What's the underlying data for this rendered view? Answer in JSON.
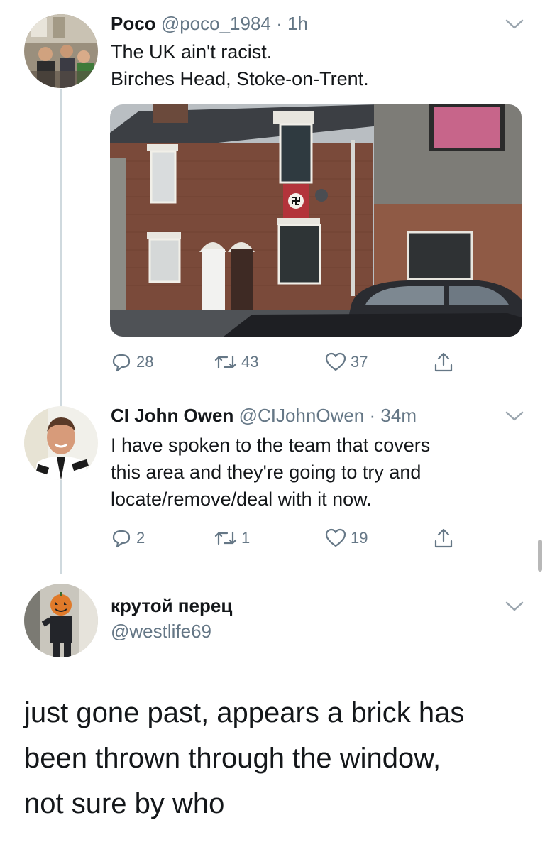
{
  "tweets": [
    {
      "name": "Poco",
      "handle": "@poco_1984",
      "time": "· 1h",
      "lines": [
        "The UK ain't racist.",
        "Birches Head, Stoke-on-Trent."
      ],
      "replies": "28",
      "retweets": "43",
      "likes": "37"
    },
    {
      "name": "CI John Owen",
      "handle": "@CIJohnOwen",
      "time": "· 34m",
      "lines": [
        "I have spoken to the team that covers",
        "this area and they're going to try and",
        "locate/remove/deal with it now."
      ],
      "replies": "2",
      "retweets": "1",
      "likes": "19"
    }
  ],
  "reply": {
    "name": "крутой перец",
    "handle": "@westlife69",
    "lines": [
      "just gone past, appears a brick has",
      "been thrown through the window,",
      "not sure by who"
    ]
  },
  "icons": {
    "reply": "reply-bubble-icon",
    "retweet": "retweet-icon",
    "like": "heart-icon",
    "share": "share-icon",
    "menu": "chevron-down-icon"
  },
  "colors": {
    "text": "#14171a",
    "muted": "#657786",
    "thread_line": "#cfd9de"
  }
}
